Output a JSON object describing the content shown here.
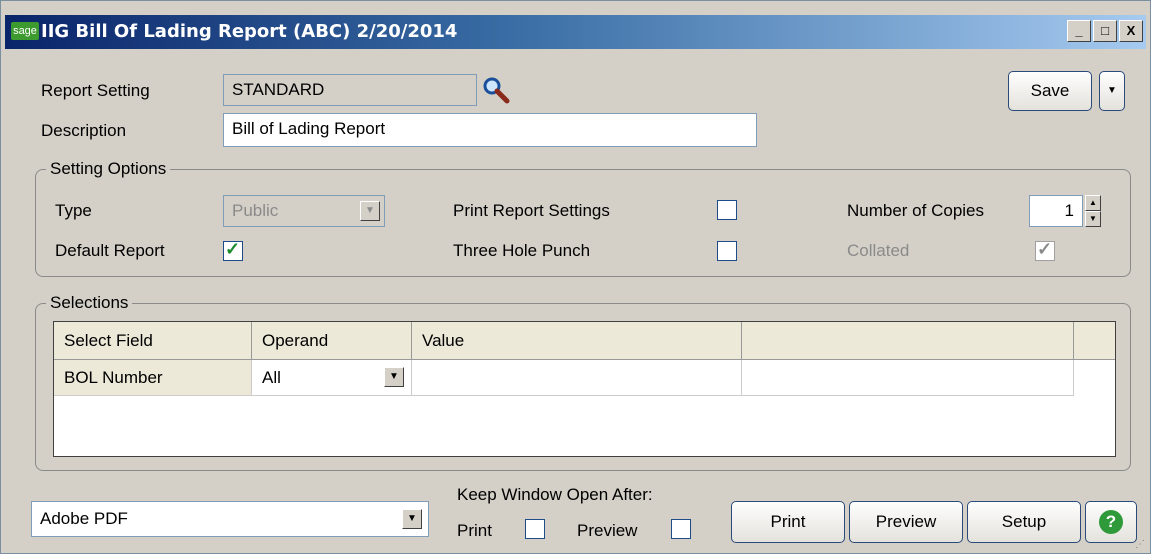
{
  "window": {
    "logo": "sage",
    "title": "IIG Bill Of Lading Report (ABC) 2/20/2014",
    "minimize": "_",
    "maximize": "□",
    "close": "X"
  },
  "header": {
    "report_setting_label": "Report Setting",
    "report_setting_value": "STANDARD",
    "description_label": "Description",
    "description_value": "Bill of Lading Report",
    "save_label": "Save"
  },
  "setting_options": {
    "legend": "Setting Options",
    "type_label": "Type",
    "type_value": "Public",
    "default_report_label": "Default Report",
    "default_report_checked": true,
    "print_report_settings_label": "Print Report Settings",
    "print_report_settings_checked": false,
    "three_hole_punch_label": "Three Hole Punch",
    "three_hole_punch_checked": false,
    "number_of_copies_label": "Number of Copies",
    "number_of_copies_value": "1",
    "collated_label": "Collated",
    "collated_checked": true
  },
  "selections": {
    "legend": "Selections",
    "columns": [
      "Select Field",
      "Operand",
      "Value",
      ""
    ],
    "rows": [
      {
        "select_field": "BOL Number",
        "operand": "All",
        "value": ""
      }
    ]
  },
  "footer": {
    "printer_value": "Adobe PDF",
    "keep_open_label": "Keep Window Open After:",
    "print_check_label": "Print",
    "preview_check_label": "Preview",
    "print_button": "Print",
    "preview_button": "Preview",
    "setup_button": "Setup",
    "help_icon": "?"
  },
  "colors": {
    "check_green": "#1c8a2e",
    "help_green": "#2f9a3a",
    "titlebar_start": "#0a246a"
  }
}
